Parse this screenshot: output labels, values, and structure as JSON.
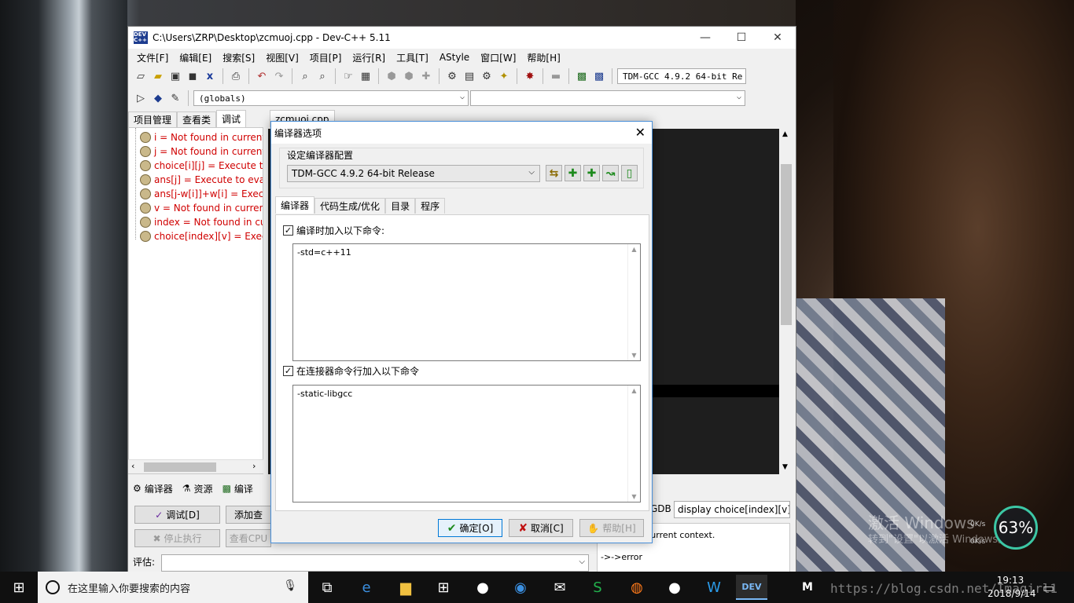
{
  "window": {
    "title": "C:\\Users\\ZRP\\Desktop\\zcmuoj.cpp - Dev-C++ 5.11",
    "app_icon_text": "DEV C++",
    "minimize": "—",
    "maximize": "☐",
    "close": "✕"
  },
  "menu": [
    "文件[F]",
    "编辑[E]",
    "搜索[S]",
    "视图[V]",
    "项目[P]",
    "运行[R]",
    "工具[T]",
    "AStyle",
    "窗口[W]",
    "帮助[H]"
  ],
  "toolbar": {
    "compiler_combo": "TDM-GCC 4.9.2 64-bit Re",
    "globals_combo": "(globals)"
  },
  "left_tabs": [
    "项目管理",
    "查看类",
    "调试"
  ],
  "file_tab": "zcmuoj.cpp",
  "watches": [
    "i = Not found in current",
    "j = Not found in current",
    "choice[i][j] = Execute to",
    "ans[j] = Execute to evalu",
    "ans[j-w[i]]+w[i] = Execu",
    "v = Not found in curren",
    "index = Not found in cu",
    "choice[index][v] = Execu"
  ],
  "bottom_tabs": [
    "编译器",
    "资源",
    "编译"
  ],
  "debug_buttons": {
    "debug": "调试[D]",
    "add_watch": "添加查",
    "stop": "停止执行",
    "view_cpu": "查看CPU"
  },
  "eval_label": "评估:",
  "gdb": {
    "label": "GDB :",
    "command": "display choice[index][v]",
    "output_line1": "\"index\" in current context.",
    "output_line2": "->->error"
  },
  "dialog": {
    "title": "编译器选项",
    "group_label": "设定编译器配置",
    "config": "TDM-GCC 4.9.2 64-bit Release",
    "tabs": [
      "编译器",
      "代码生成/优化",
      "目录",
      "程序"
    ],
    "compile_check_label": "编译时加入以下命令:",
    "compile_check": "✓",
    "compile_cmd": "-std=c++11",
    "linker_check_label": "在连接器命令行加入以下命令",
    "linker_check": "✓",
    "linker_cmd": "-static-libgcc",
    "ok": "确定[O]",
    "cancel": "取消[C]",
    "help": "帮助[H]",
    "close": "✕"
  },
  "watermark": {
    "line1": "激活 Windows",
    "line2": "转到\"设置\"以激活 Windows。",
    "gauge": "63%",
    "up": "0K/s",
    "down": "0K/s"
  },
  "taskbar": {
    "search_placeholder": "在这里输入你要搜索的内容",
    "url_overlay": "https://blog.csdn.net/Imagirl1",
    "time": "19:13",
    "date": "2018/9/14",
    "ime": "M"
  },
  "colors": {
    "watch_text": "#d00000",
    "accent": "#0078d7",
    "editor_bg": "#1e1e1e"
  }
}
